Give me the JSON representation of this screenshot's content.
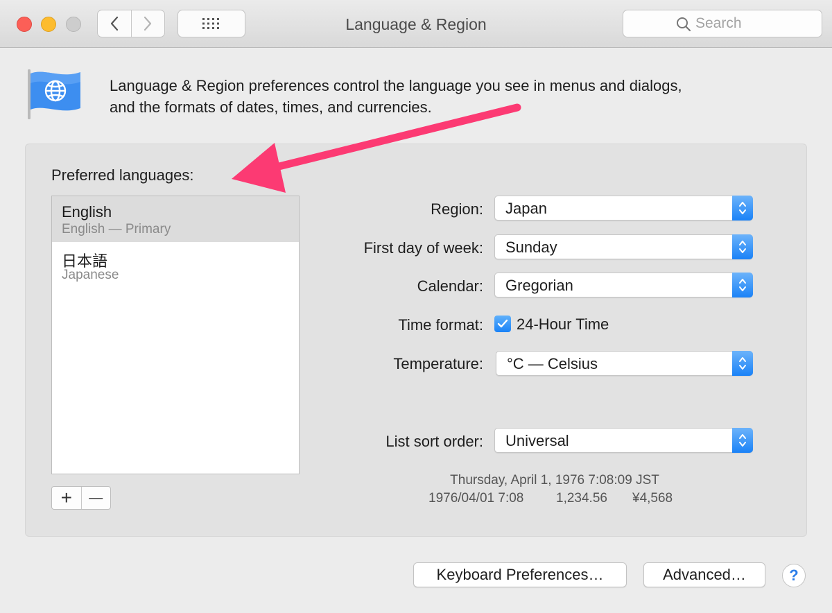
{
  "window": {
    "title": "Language & Region",
    "search_placeholder": "Search"
  },
  "header": {
    "description_line1": "Language & Region preferences control the language you see in menus and dialogs,",
    "description_line2": "and the formats of dates, times, and currencies."
  },
  "languages": {
    "label": "Preferred languages:",
    "items": [
      {
        "name": "English",
        "subtitle": "English — Primary",
        "selected": true
      },
      {
        "name": "日本語",
        "subtitle": "Japanese",
        "selected": false
      }
    ],
    "add_symbol": "+",
    "remove_symbol": "—"
  },
  "settings": {
    "region_label": "Region:",
    "region_value": "Japan",
    "first_day_label": "First day of week:",
    "first_day_value": "Sunday",
    "calendar_label": "Calendar:",
    "calendar_value": "Gregorian",
    "time_format_label": "Time format:",
    "time_format_checkbox": "24-Hour Time",
    "time_format_checked": true,
    "temperature_label": "Temperature:",
    "temperature_value": "°C — Celsius",
    "sort_order_label": "List sort order:",
    "sort_order_value": "Universal"
  },
  "samples": {
    "long_date": "Thursday, April 1, 1976 7:08:09 JST",
    "short_date": "1976/04/01 7:08",
    "number": "1,234.56",
    "currency": "¥4,568"
  },
  "footer": {
    "keyboard_button": "Keyboard Preferences…",
    "advanced_button": "Advanced…",
    "help_symbol": "?"
  },
  "colors": {
    "accent": "#1a82f7",
    "annotation_arrow": "#fc3a73"
  }
}
